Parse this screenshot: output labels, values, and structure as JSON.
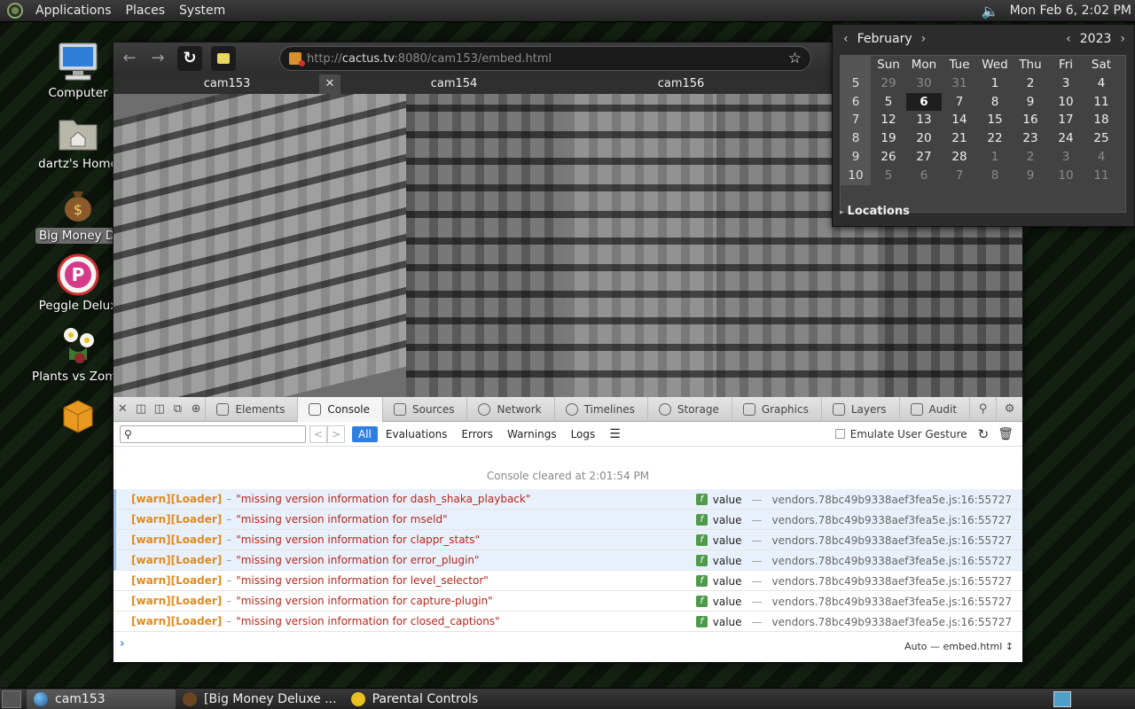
{
  "top_panel": {
    "menus": [
      "Applications",
      "Places",
      "System"
    ],
    "clock": "Mon Feb  6,  2:02 PM"
  },
  "desktop_icons": [
    {
      "label": "Computer"
    },
    {
      "label": "dartz's Home"
    },
    {
      "label": "Big Money Delu"
    },
    {
      "label": "Peggle Delux"
    },
    {
      "label": "Plants vs Zomb"
    }
  ],
  "browser": {
    "url_scheme": "http://",
    "url_host": "cactus.tv",
    "url_rest": ":8080/cam153/embed.html",
    "tabs": [
      "cam153",
      "cam154",
      "cam156"
    ]
  },
  "devtools": {
    "tabs": [
      "Elements",
      "Console",
      "Sources",
      "Network",
      "Timelines",
      "Storage",
      "Graphics",
      "Layers",
      "Audit"
    ],
    "filters": [
      "All",
      "Evaluations",
      "Errors",
      "Warnings",
      "Logs"
    ],
    "emulate_label": "Emulate User Gesture",
    "cleared_note": "Console cleared at 2:01:54  PM",
    "rows": [
      {
        "tag": "[warn][Loader]",
        "msg": "\"missing version information for dash_shaka_playback\"",
        "val": "value",
        "src": "vendors.78bc49b9338aef3fea5e.js:16:55727"
      },
      {
        "tag": "[warn][Loader]",
        "msg": "\"missing version information for mseld\"",
        "val": "value",
        "src": "vendors.78bc49b9338aef3fea5e.js:16:55727"
      },
      {
        "tag": "[warn][Loader]",
        "msg": "\"missing version information for clappr_stats\"",
        "val": "value",
        "src": "vendors.78bc49b9338aef3fea5e.js:16:55727"
      },
      {
        "tag": "[warn][Loader]",
        "msg": "\"missing version information for error_plugin\"",
        "val": "value",
        "src": "vendors.78bc49b9338aef3fea5e.js:16:55727"
      },
      {
        "tag": "[warn][Loader]",
        "msg": "\"missing version information for level_selector\"",
        "val": "value",
        "src": "vendors.78bc49b9338aef3fea5e.js:16:55727"
      },
      {
        "tag": "[warn][Loader]",
        "msg": "\"missing version information for capture-plugin\"",
        "val": "value",
        "src": "vendors.78bc49b9338aef3fea5e.js:16:55727"
      },
      {
        "tag": "[warn][Loader]",
        "msg": "\"missing version information for closed_captions\"",
        "val": "value",
        "src": "vendors.78bc49b9338aef3fea5e.js:16:55727"
      }
    ],
    "context_label": "Auto — embed.html"
  },
  "calendar": {
    "month": "February",
    "year": "2023",
    "weekdays": [
      "Sun",
      "Mon",
      "Tue",
      "Wed",
      "Thu",
      "Fri",
      "Sat"
    ],
    "weeks": [
      {
        "wk": "5",
        "days": [
          "29",
          "30",
          "31",
          "1",
          "2",
          "3",
          "4"
        ]
      },
      {
        "wk": "6",
        "days": [
          "5",
          "6",
          "7",
          "8",
          "9",
          "10",
          "11"
        ]
      },
      {
        "wk": "7",
        "days": [
          "12",
          "13",
          "14",
          "15",
          "16",
          "17",
          "18"
        ]
      },
      {
        "wk": "8",
        "days": [
          "19",
          "20",
          "21",
          "22",
          "23",
          "24",
          "25"
        ]
      },
      {
        "wk": "9",
        "days": [
          "26",
          "27",
          "28",
          "1",
          "2",
          "3",
          "4"
        ]
      },
      {
        "wk": "10",
        "days": [
          "5",
          "6",
          "7",
          "8",
          "9",
          "10",
          "11"
        ]
      }
    ],
    "locations_label": "Locations"
  },
  "taskbar": {
    "tasks": [
      "cam153",
      "[Big Money Deluxe ...",
      "Parental Controls"
    ]
  }
}
